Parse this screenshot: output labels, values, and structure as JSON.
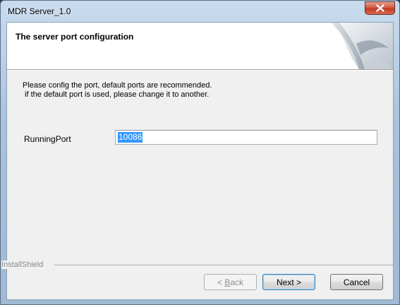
{
  "window": {
    "title": "MDR Server_1.0"
  },
  "header": {
    "title": "The server port configuration"
  },
  "description": {
    "line1": "Please config the port, default ports are recommended.",
    "line2": " if the default port is used, please change it to another."
  },
  "form": {
    "running_port_label": "RunningPort",
    "running_port_value": "10086"
  },
  "footer": {
    "brand": "InstallShield"
  },
  "buttons": {
    "back": {
      "prefix": "< ",
      "mnemonic": "B",
      "rest": "ack"
    },
    "next": "Next >",
    "cancel": "Cancel"
  },
  "colors": {
    "selection": "#3399ff",
    "close_button": "#c23a22"
  },
  "icons": {
    "close": "close-icon",
    "header_graphic": "page-curl-graphic"
  }
}
